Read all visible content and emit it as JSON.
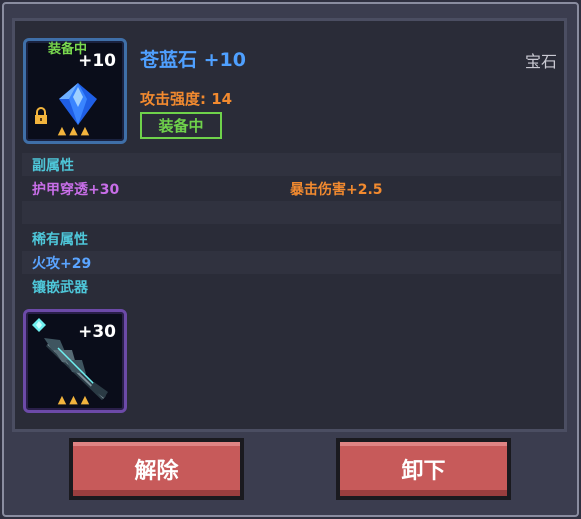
{
  "item": {
    "name": "苍蓝石 +10",
    "category": "宝石",
    "attack_stat": "攻击强度: 14",
    "equipped_badge": "装备中",
    "slot_tag": "装备中",
    "level": "+10",
    "stars": "▲▲▲"
  },
  "secondary": {
    "header": "副属性",
    "stat_left": "护甲穿透+30",
    "stat_right": "暴击伤害+2.5"
  },
  "rare": {
    "header": "稀有属性",
    "stat": "火攻+29"
  },
  "socket": {
    "header": "镶嵌武器",
    "weapon_level": "+30",
    "weapon_stars": "▲▲▲"
  },
  "buttons": {
    "remove": "解除",
    "unequip": "卸下"
  },
  "colors": {
    "title": "#4fa0ff",
    "attack": "#f28a2f",
    "equipped": "#6fd24b",
    "button": "#c75a5a"
  },
  "icons": {
    "gem": "blue-gem-icon",
    "lock": "lock-icon",
    "weapon": "trident-weapon-icon",
    "socket_gem": "cyan-gem-icon"
  }
}
